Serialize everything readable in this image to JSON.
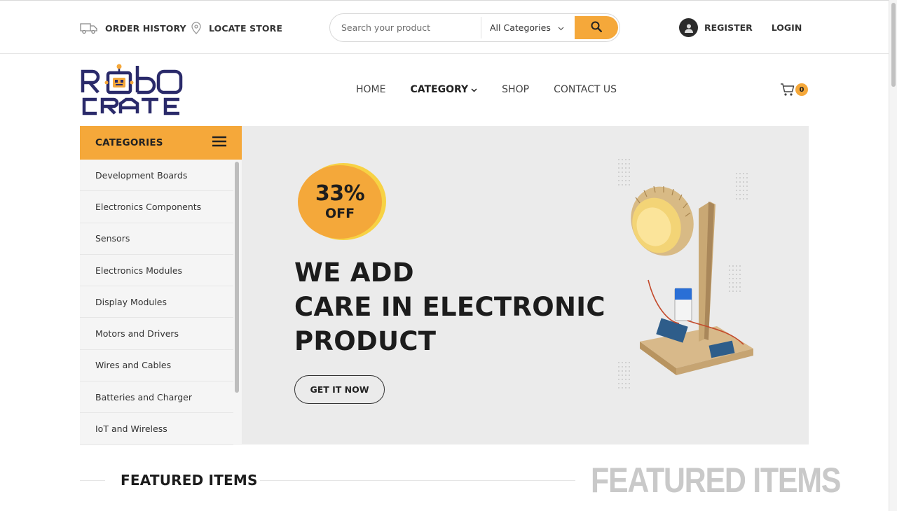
{
  "topbar": {
    "order_history": "ORDER HISTORY",
    "locate_store": "LOCATE STORE",
    "search_placeholder": "Search your product",
    "category_select": "All Categories",
    "register": "REGISTER",
    "login": "LOGIN"
  },
  "header": {
    "logo_line1": "RoboCRATE",
    "nav": [
      {
        "label": "HOME"
      },
      {
        "label": "CATEGORY"
      },
      {
        "label": "SHOP"
      },
      {
        "label": "CONTACT US"
      }
    ],
    "cart_count": "0"
  },
  "categories": {
    "title": "CATEGORIES",
    "items": [
      {
        "label": "Development Boards"
      },
      {
        "label": "Electronics Components"
      },
      {
        "label": "Sensors"
      },
      {
        "label": "Electronics Modules"
      },
      {
        "label": "Display Modules"
      },
      {
        "label": "Motors and Drivers"
      },
      {
        "label": "Wires and Cables"
      },
      {
        "label": "Batteries and Charger"
      },
      {
        "label": "IoT and Wireless"
      }
    ]
  },
  "hero": {
    "discount_pct": "33%",
    "discount_off": "OFF",
    "headline": [
      "WE ADD",
      "CARE IN ELECTRONIC",
      "PRODUCT"
    ],
    "cta": "GET IT NOW"
  },
  "featured": {
    "title": "FEATURED ITEMS",
    "ghost_title": "FEATURED ITEMS"
  },
  "colors": {
    "accent": "#f5a83a",
    "logo_navy": "#2a2a6a",
    "hero_bg": "#ebebeb"
  }
}
